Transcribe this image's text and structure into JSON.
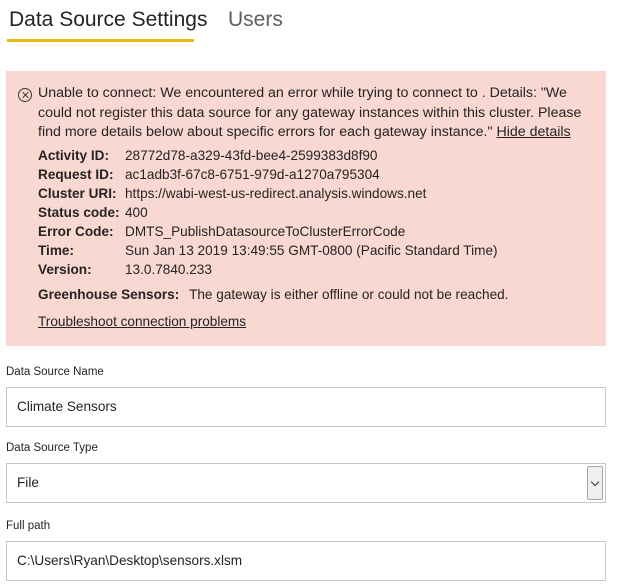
{
  "tabs": [
    {
      "label": "Data Source Settings",
      "active": true
    },
    {
      "label": "Users",
      "active": false
    }
  ],
  "colors": {
    "tab_underline": "#e8b90f",
    "error_background": "#f8d8d1"
  },
  "error": {
    "icon": "error-circle-x-icon",
    "message": "Unable to connect: We encountered an error while trying to connect to . Details: \"We could not register this data source for any gateway instances within this cluster. Please find more details below about specific errors for each gateway instance.\"",
    "hide_details_link": "Hide details",
    "details": [
      {
        "label": "Activity ID:",
        "value": "28772d78-a329-43fd-bee4-2599383d8f90"
      },
      {
        "label": "Request ID:",
        "value": "ac1adb3f-67c8-6751-979d-a1270a795304"
      },
      {
        "label": "Cluster URI:",
        "value": "https://wabi-west-us-redirect.analysis.windows.net"
      },
      {
        "label": "Status code:",
        "value": "400"
      },
      {
        "label": "Error Code:",
        "value": "DMTS_PublishDatasourceToClusterErrorCode"
      },
      {
        "label": "Time:",
        "value": "Sun Jan 13 2019 13:49:55 GMT-0800 (Pacific Standard Time)"
      },
      {
        "label": "Version:",
        "value": "13.0.7840.233"
      }
    ],
    "gateway": {
      "label": "Greenhouse Sensors:",
      "message": "The gateway is either offline or could not be reached."
    },
    "troubleshoot_link": "Troubleshoot connection problems"
  },
  "form": {
    "data_source_name": {
      "label": "Data Source Name",
      "value": "Climate Sensors"
    },
    "data_source_type": {
      "label": "Data Source Type",
      "value": "File"
    },
    "full_path": {
      "label": "Full path",
      "value": "C:\\Users\\Ryan\\Desktop\\sensors.xlsm"
    }
  }
}
